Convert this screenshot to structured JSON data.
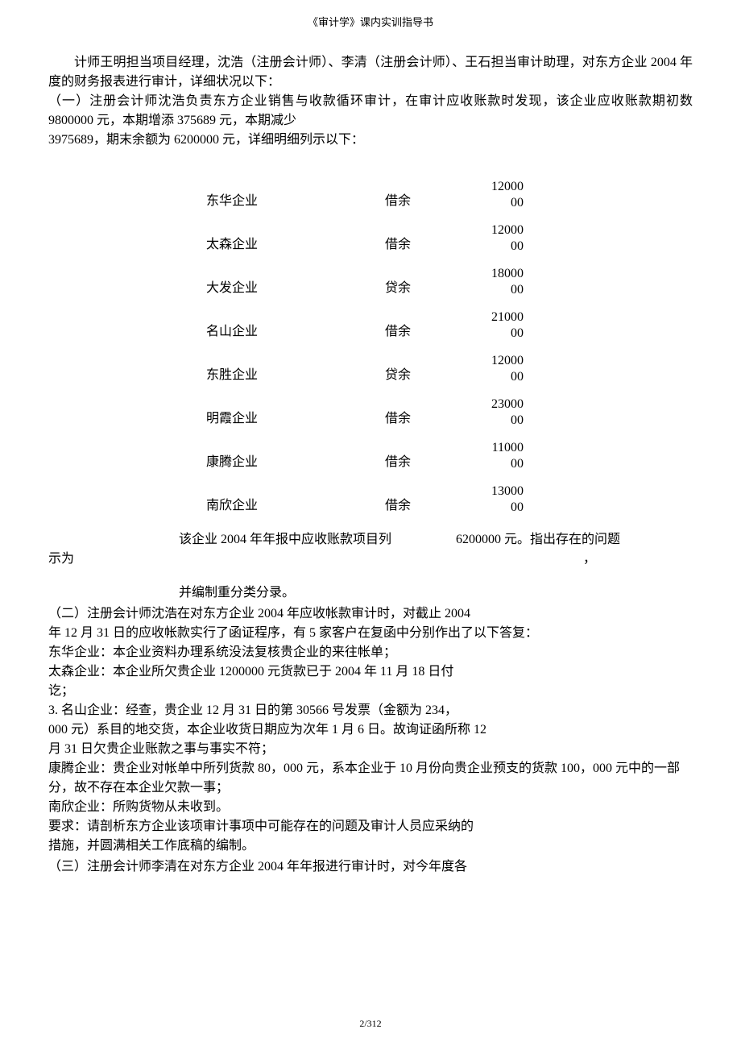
{
  "header": {
    "title": "《审计学》课内实训指导书"
  },
  "intro": {
    "p1": "计师王明担当项目经理，沈浩（注册会计师）、李清（注册会计师）、王石担当审计助理，对东方企业 2004 年度的财务报表进行审计，详细状况以下：",
    "p2": "（一）注册会计师沈浩负责东方企业销售与收款循环审计，在审计应收账款时发现，该企业应收账款期初数 9800000 元，本期增添 375689 元，本期减少",
    "p3": "3975689，期末余额为 6200000 元，详细明细列示以下："
  },
  "table": {
    "rows": [
      {
        "name": "东华企业",
        "type": "借余",
        "amount_top": "12000",
        "amount_bot": "00"
      },
      {
        "name": "太森企业",
        "type": "借余",
        "amount_top": "12000",
        "amount_bot": "00"
      },
      {
        "name": "大发企业",
        "type": "贷余",
        "amount_top": "18000",
        "amount_bot": "00"
      },
      {
        "name": "名山企业",
        "type": "借余",
        "amount_top": "21000",
        "amount_bot": "00"
      },
      {
        "name": "东胜企业",
        "type": "贷余",
        "amount_top": "12000",
        "amount_bot": "00"
      },
      {
        "name": "明霞企业",
        "type": "借余",
        "amount_top": "23000",
        "amount_bot": "00"
      },
      {
        "name": "康腾企业",
        "type": "借余",
        "amount_top": "11000",
        "amount_bot": "00"
      },
      {
        "name": "南欣企业",
        "type": "借余",
        "amount_top": "13000",
        "amount_bot": "00"
      }
    ]
  },
  "summary": {
    "left": "该企业 2004 年年报中应收账款项目列",
    "right": "6200000 元。指出存在的问题",
    "line2a": "示为",
    "line2b": "，",
    "reclass": "并编制重分类分录。"
  },
  "section2": {
    "l1": "（二）注册会计师沈浩在对东方企业 2004 年应收帐款审计时，对截止 2004",
    "l2": "年 12 月 31 日的应收帐款实行了函证程序，有 5 家客户在复函中分别作出了以下答复：",
    "l3": "东华企业：本企业资料办理系统没法复核贵企业的来往帐单；",
    "l4": "太森企业：本企业所欠贵企业 1200000 元货款已于 2004 年 11 月 18 日付",
    "l5": "讫；",
    "l6": "3. 名山企业：经查，贵企业 12 月 31 日的第 30566 号发票（金额为 234，",
    "l7": "000 元）系目的地交货，本企业收货日期应为次年 1 月 6 日。故询证函所称 12",
    "l8": "月 31 日欠贵企业账款之事与事实不符；",
    "l9": "康腾企业：贵企业对帐单中所列货款 80，000 元，系本企业于 10 月份向贵企业预支的货款 100，000 元中的一部分，故不存在本企业欠款一事；",
    "l10": "南欣企业：所购货物从未收到。",
    "l11": "要求：请剖析东方企业该项审计事项中可能存在的问题及审计人员应采纳的",
    "l12": "措施，并圆满相关工作底稿的编制。"
  },
  "section3": {
    "l1": "（三）注册会计师李清在对东方企业 2004 年年报进行审计时，对今年度各"
  },
  "footer": {
    "page": "2/312"
  }
}
